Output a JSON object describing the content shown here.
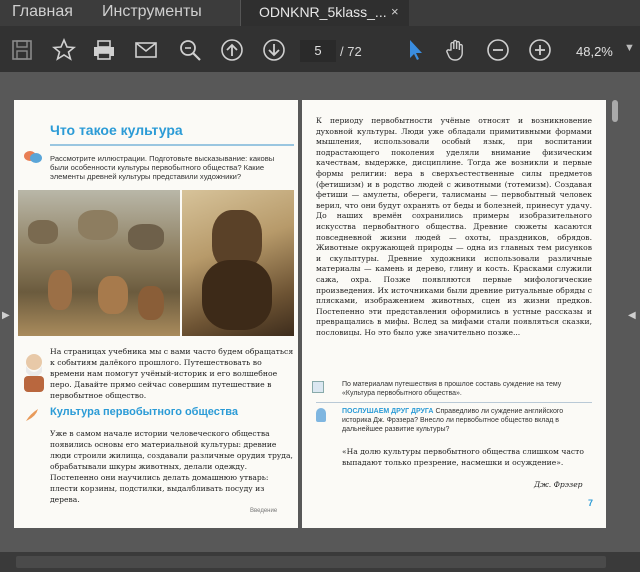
{
  "menu": {
    "home": "Главная",
    "tools": "Инструменты"
  },
  "tab": {
    "title": "ODNKNR_5klass_...",
    "close": "×"
  },
  "toolbar": {
    "icons": [
      "save-icon",
      "star-icon",
      "print-icon",
      "mail-icon",
      "zoom-search-icon",
      "page-up-icon",
      "page-down-icon",
      "pointer-icon",
      "hand-icon",
      "zoom-out-icon",
      "zoom-in-icon"
    ],
    "page_current": "5",
    "page_total": "/ 72",
    "zoom": "48,2%"
  },
  "left_page": {
    "title": "Что такое культура",
    "question": "Рассмотрите иллюстрации. Подготовьте высказывание: каковы были особенности культуры первобытного общества? Какие элементы древней культуры представили художники?",
    "intro": "На страницах учебника мы с вами часто будем обращаться к событиям далёкого прошлого. Путешествовать во времени нам помогут учёный-историк и его волшебное перо. Давайте прямо сейчас совершим путешествие в первобытное общество.",
    "section_title": "Культура первобытного общества",
    "body": "Уже в самом начале истории человеческого общества появились основы его материальной культуры: древние люди строили жилища, создавали различные орудия труда, обрабатывали шкуры животных, делали одежду. Постепенно они научились делать домашнюю утварь: плести корзины, подстилки, выдалбливать посуду из дерева.",
    "footer": "Введение"
  },
  "right_page": {
    "body": "К периоду первобытности учёные относят и возникновение духовной культуры. Люди уже обладали примитивными формами мышления, использовали особый язык, при воспитании подрастающего поколения уделяли внимание физическим качествам, выдержке, дисциплине. Тогда же возникли и первые формы религии: вера в сверхъестественные силы предметов (фетишизм) и в родство людей с животными (тотемизм). Создавая фетиши — амулеты, обереги, талисманы — первобытный человек верил, что они будут охранять от беды и болезней, принесут удачу. До наших времён сохранились примеры изобразительного искусства первобытного общества. Древние сюжеты касаются повседневной жизни людей — охоты, праздников, обрядов. Животные окружающей природы — одна из главных тем рисунков и скульптуры. Древние художники использовали различные материалы — камень и дерево, глину и кость. Красками служили сажа, охра. Позже появляются первые мифологические произведения. Их источниками были древние ритуальные обряды с плясками, изображением животных, сцен из жизни предков. Постепенно эти представления оформились в устные рассказы и превращались в мифы. Вслед за мифами стали появляться сказки, пословицы. Но это было уже значительно позже...",
    "task": "По материалам путешествия в прошлое составь суждение на тему «Культура первобытного общества».",
    "friend_label": "ПОСЛУШАЕМ ДРУГ ДРУГА",
    "friend_text": " Справедливо ли суждение английского историка Дж. Фрэзера? Внесло ли первобытное общество вклад в дальнейшее развитие культуры?",
    "quote": "«На долю культуры первобытного общества слишком часто выпадают только презрение, насмешки и осуждение».",
    "author": "Дж. Фрэзер",
    "page_number": "7"
  }
}
